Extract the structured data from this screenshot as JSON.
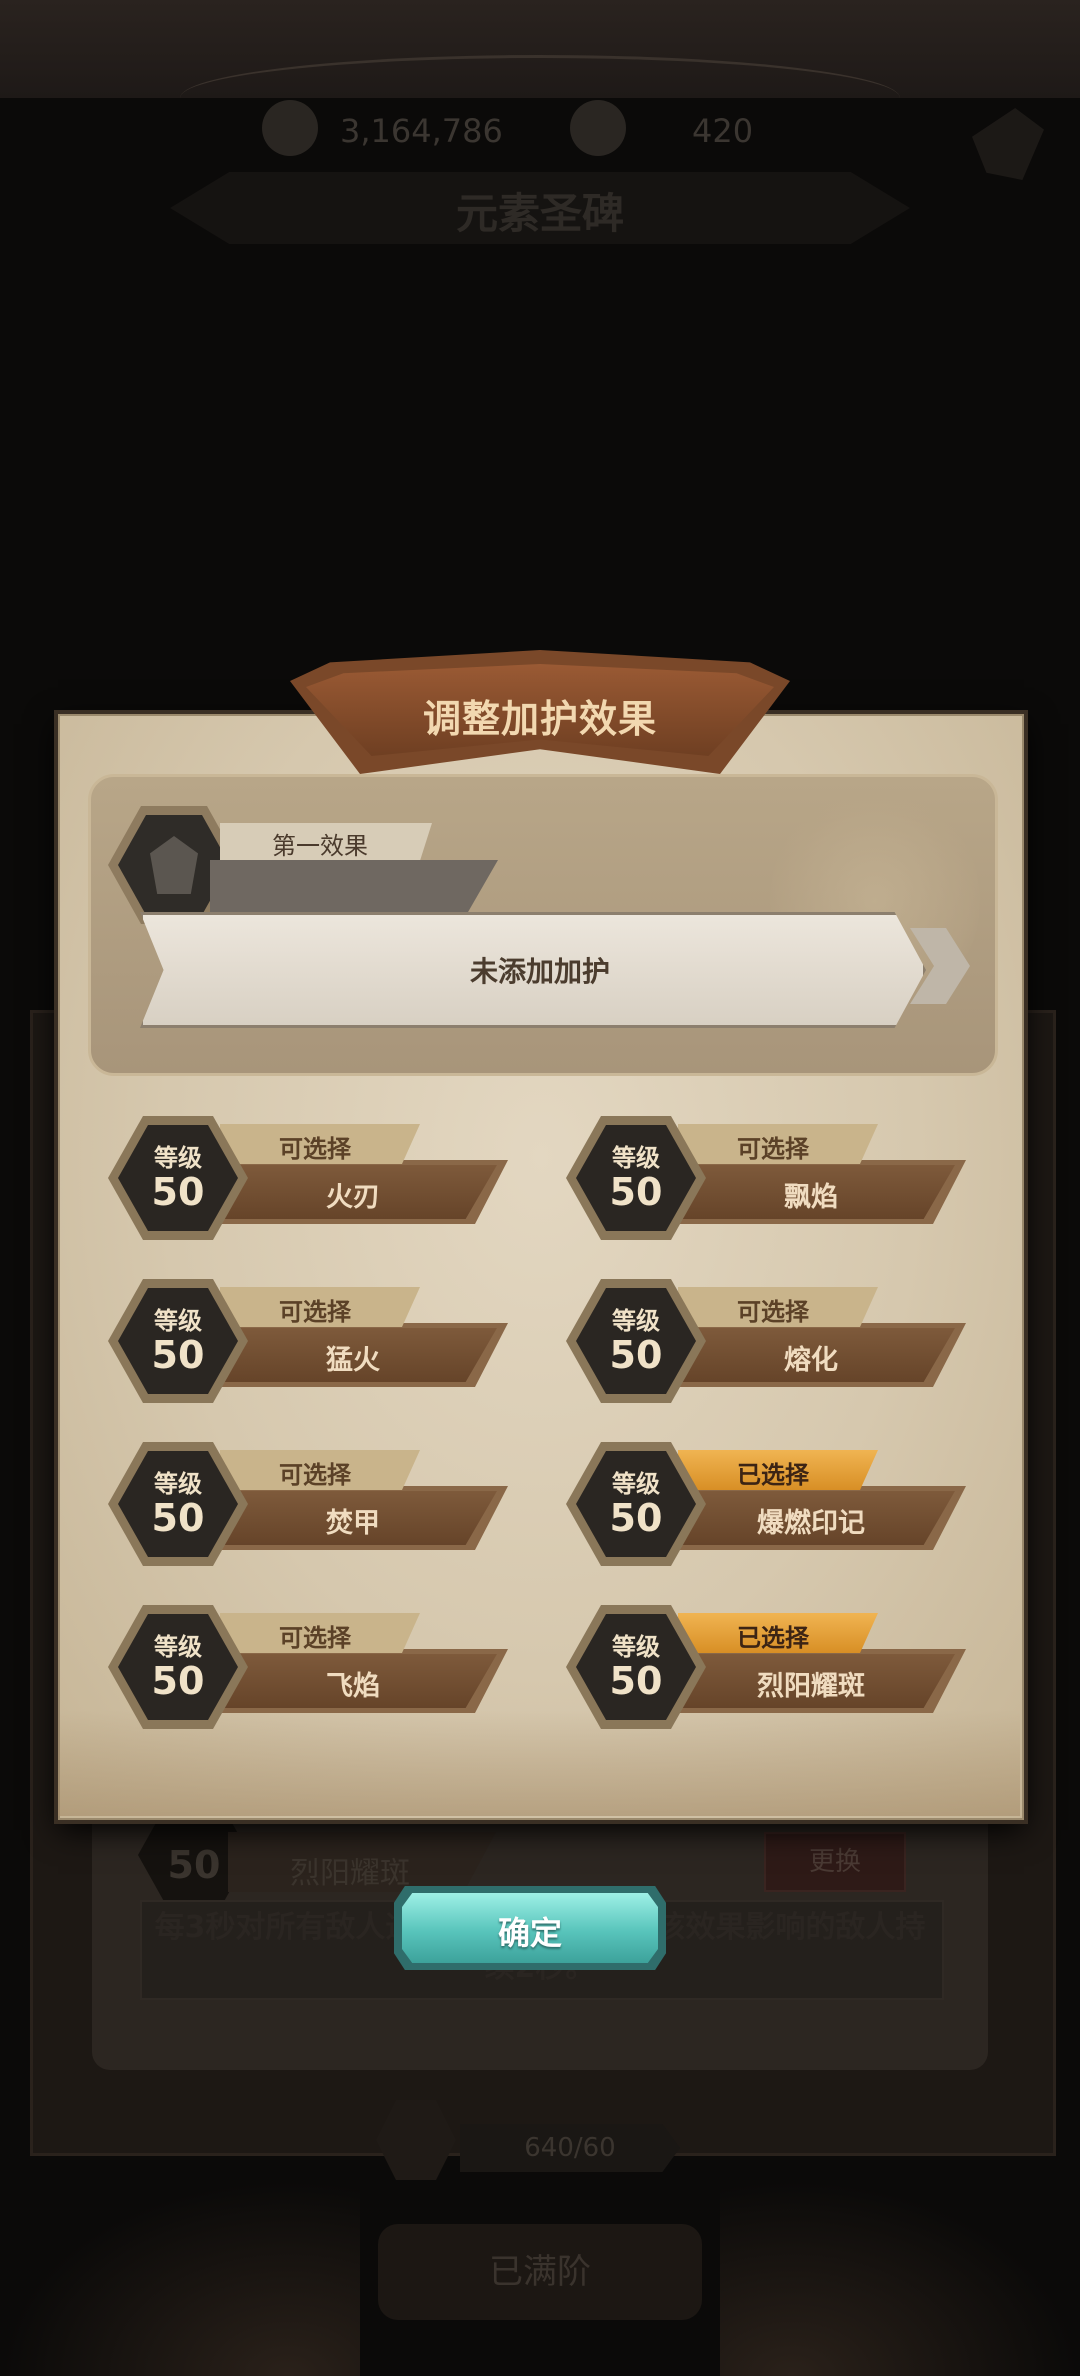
{
  "background": {
    "gold_amount": "3,164,786",
    "gem_amount": "420",
    "screen_title": "元素圣碑",
    "selected_level": "50",
    "selected_name": "烈阳耀斑",
    "change_label": "更换",
    "description": "每3秒对所有敌人造成属性伤害，受到该效果影响的敌人持续2秒。",
    "progress": "640/60",
    "max_label": "已满阶"
  },
  "dialog": {
    "title": "调整加护效果",
    "first_effect": {
      "tag": "第一效果",
      "slot_text": "未添加加护"
    },
    "options": [
      {
        "level_label": "等级",
        "level": "50",
        "status": "可选择",
        "name": "火刃",
        "selected": false
      },
      {
        "level_label": "等级",
        "level": "50",
        "status": "可选择",
        "name": "飘焰",
        "selected": false
      },
      {
        "level_label": "等级",
        "level": "50",
        "status": "可选择",
        "name": "猛火",
        "selected": false
      },
      {
        "level_label": "等级",
        "level": "50",
        "status": "可选择",
        "name": "熔化",
        "selected": false
      },
      {
        "level_label": "等级",
        "level": "50",
        "status": "可选择",
        "name": "焚甲",
        "selected": false
      },
      {
        "level_label": "等级",
        "level": "50",
        "status": "已选择",
        "name": "爆燃印记",
        "selected": true
      },
      {
        "level_label": "等级",
        "level": "50",
        "status": "可选择",
        "name": "飞焰",
        "selected": false
      },
      {
        "level_label": "等级",
        "level": "50",
        "status": "已选择",
        "name": "烈阳耀斑",
        "selected": true
      }
    ],
    "confirm_label": "确定"
  },
  "colors": {
    "parchment": "#d6c8ae",
    "selected_tag": "#e8a23a",
    "confirm_button": "#58c4bb",
    "title_banner": "#7a4829"
  }
}
